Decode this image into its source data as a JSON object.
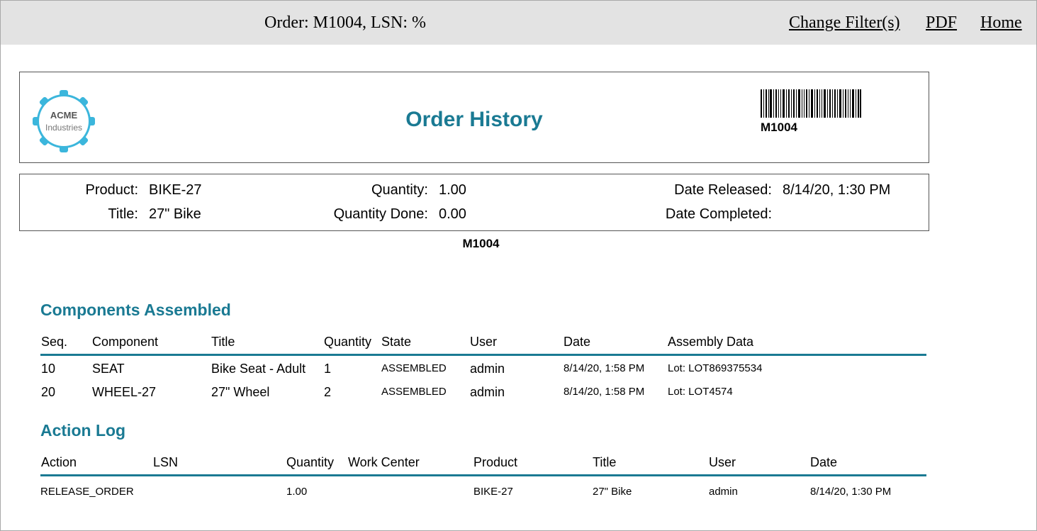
{
  "topbar": {
    "order_text": "Order: M1004, LSN: %",
    "links": [
      "Change Filter(s)",
      "PDF",
      "Home"
    ]
  },
  "header": {
    "logo_line1": "ACME",
    "logo_line2": "Industries",
    "title": "Order History",
    "barcode_text": "M1004"
  },
  "info": {
    "product_label": "Product:",
    "product": "BIKE-27",
    "title_label": "Title:",
    "title": "27\" Bike",
    "quantity_label": "Quantity:",
    "quantity": "1.00",
    "quantity_done_label": "Quantity Done:",
    "quantity_done": "0.00",
    "date_released_label": "Date Released:",
    "date_released": "8/14/20, 1:30 PM",
    "date_completed_label": "Date Completed:",
    "date_completed": ""
  },
  "order_id": "M1004",
  "components": {
    "heading": "Components Assembled",
    "columns": [
      "Seq.",
      "Component",
      "Title",
      "Quantity",
      "State",
      "User",
      "Date",
      "Assembly Data"
    ],
    "rows": [
      [
        "10",
        "SEAT",
        "Bike Seat - Adult",
        "1",
        "ASSEMBLED",
        "admin",
        "8/14/20, 1:58 PM",
        "Lot: LOT869375534"
      ],
      [
        "20",
        "WHEEL-27",
        "27\" Wheel",
        "2",
        "ASSEMBLED",
        "admin",
        "8/14/20, 1:58 PM",
        "Lot: LOT4574"
      ]
    ]
  },
  "action_log": {
    "heading": "Action Log",
    "columns": [
      "Action",
      "LSN",
      "Quantity",
      "Work Center",
      "Product",
      "Title",
      "User",
      "Date"
    ],
    "rows": [
      [
        "RELEASE_ORDER",
        "",
        "1.00",
        "",
        "BIKE-27",
        "27\" Bike",
        "admin",
        "8/14/20, 1:30 PM"
      ]
    ]
  },
  "colors": {
    "accent": "#1a7a93",
    "topbar": "#e3e3e3",
    "logo": "#3bb6dc"
  }
}
